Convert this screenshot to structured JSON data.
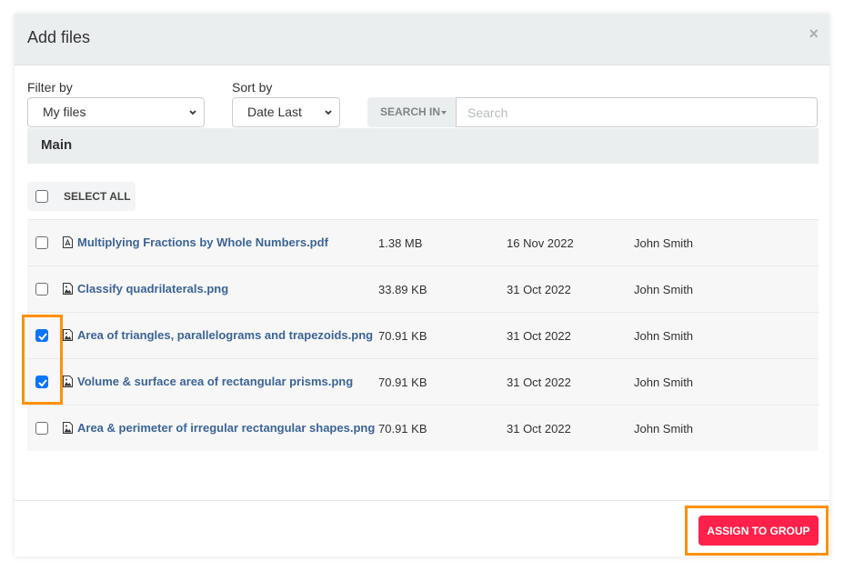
{
  "modal": {
    "title": "Add files",
    "close_icon": "×"
  },
  "filters": {
    "filter_label": "Filter by",
    "filter_value": "My files",
    "sort_label": "Sort by",
    "sort_value": "Date Last",
    "search_in_label": "SEARCH IN",
    "search_value": "",
    "search_placeholder": "Search"
  },
  "folder": {
    "name": "Main"
  },
  "select_all": {
    "label": "SELECT ALL",
    "checked": false
  },
  "files": [
    {
      "name": "Multiplying Fractions by Whole Numbers.pdf",
      "type": "pdf",
      "size": "1.38 MB",
      "date": "16 Nov 2022",
      "owner": "John Smith",
      "checked": false
    },
    {
      "name": "Classify quadrilaterals.png",
      "type": "image",
      "size": "33.89 KB",
      "date": "31 Oct 2022",
      "owner": "John Smith",
      "checked": false
    },
    {
      "name": "Area of triangles, parallelograms and trapezoids.png",
      "type": "image",
      "size": "70.91 KB",
      "date": "31 Oct 2022",
      "owner": "John Smith",
      "checked": true
    },
    {
      "name": "Volume & surface area of rectangular prisms.png",
      "type": "image",
      "size": "70.91 KB",
      "date": "31 Oct 2022",
      "owner": "John Smith",
      "checked": true
    },
    {
      "name": "Area & perimeter of irregular rectangular shapes.png",
      "type": "image",
      "size": "70.91 KB",
      "date": "31 Oct 2022",
      "owner": "John Smith",
      "checked": false
    }
  ],
  "footer": {
    "assign_label": "ASSIGN TO GROUP"
  },
  "colors": {
    "accent": "#ff2149",
    "link": "#3c6496",
    "checkbox_checked": "#0a75ff",
    "highlight": "#ff9000",
    "header_bg": "#ebeeef"
  }
}
